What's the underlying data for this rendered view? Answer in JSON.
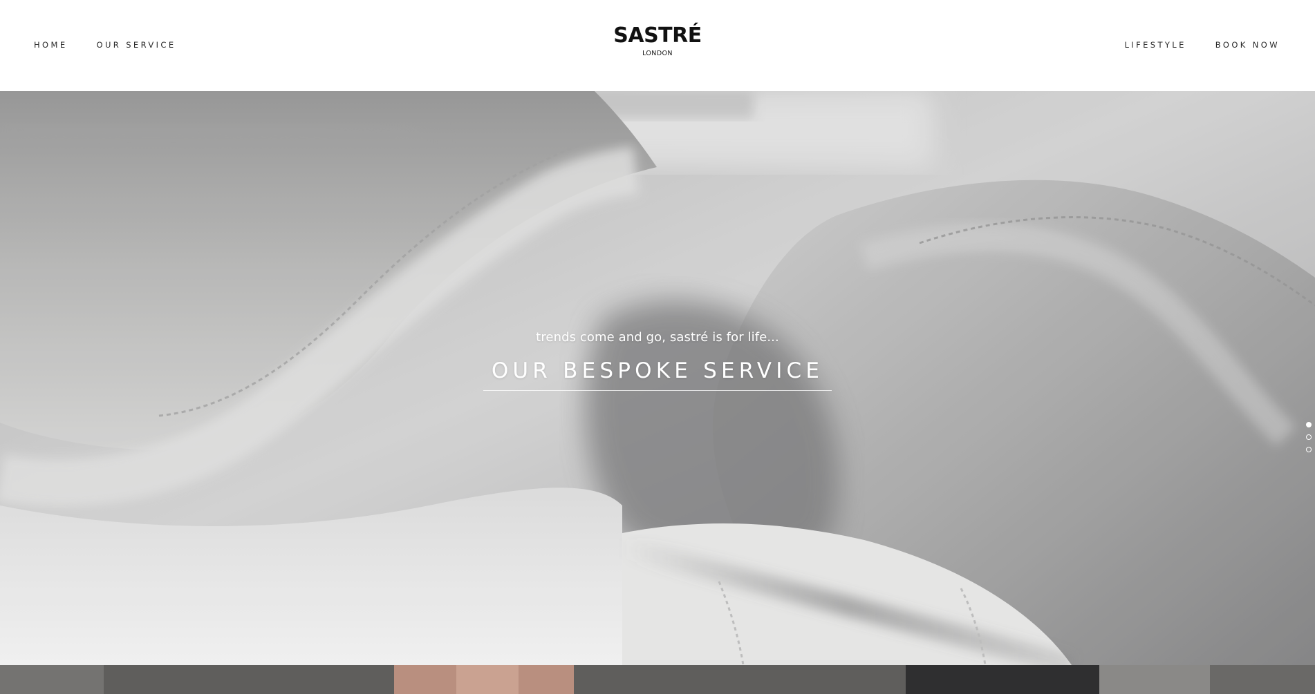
{
  "brand": {
    "name": "SASTRÉ",
    "location": "LONDON"
  },
  "nav": {
    "left": [
      {
        "label": "HOME"
      },
      {
        "label": "OUR SERVICE"
      }
    ],
    "right": [
      {
        "label": "LIFESTYLE"
      },
      {
        "label": "BOOK NOW"
      }
    ]
  },
  "hero": {
    "tagline": "trends come and go, sastré is for life...",
    "cta_label": "OUR BESPOKE SERVICE",
    "image": "white-shirt-collar-closeup",
    "slides": {
      "count": 3,
      "active": 1
    }
  },
  "colors": {
    "header_bg": "#ffffff",
    "nav_text": "#2a2a2a",
    "logo": "#111111",
    "hero_text": "#ffffff"
  }
}
